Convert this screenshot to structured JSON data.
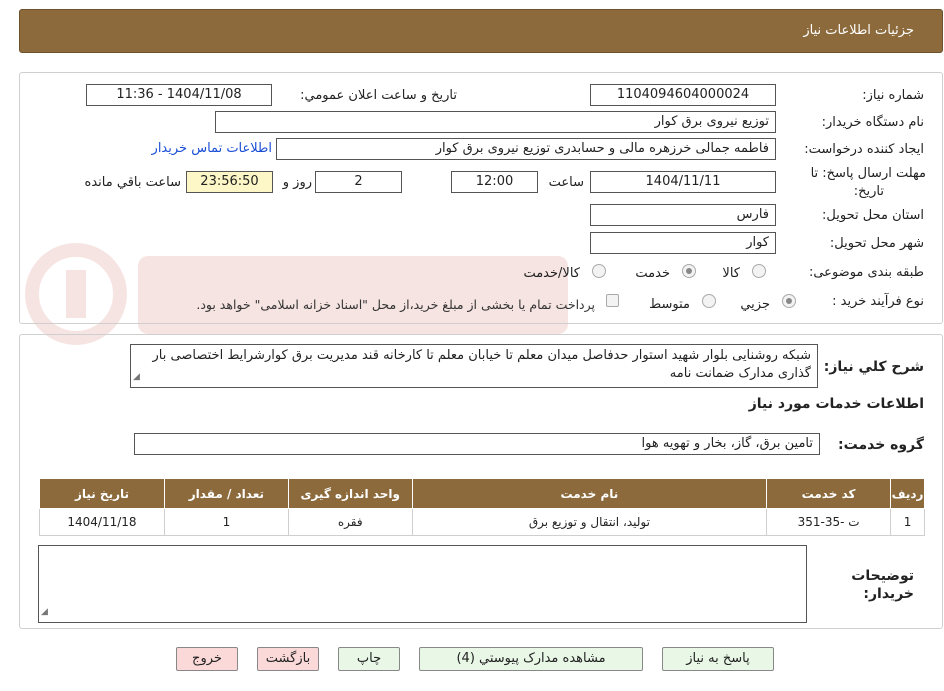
{
  "title": "جزئیات اطلاعات نیاز",
  "fields": {
    "need_no_label": "شماره نیاز:",
    "need_no": "1104094604000024",
    "announce_label": "تاریخ و ساعت اعلان عمومي:",
    "announce_value": "1404/11/08 - 11:36",
    "buyer_label": "نام دستگاه خریدار:",
    "buyer_value": "توزیع نیروی برق کوار",
    "creator_label": "ایجاد کننده درخواست:",
    "creator_value": "فاطمه جمالی خرزهره مالی و حسابدری توزیع نیروی برق کوار",
    "contact_link": "اطلاعات تماس خریدار",
    "deadline_label_1": "مهلت ارسال پاسخ: تا",
    "deadline_label_2": "تاریخ:",
    "deadline_date": "1404/11/11",
    "time_label": "ساعت",
    "deadline_time": "12:00",
    "days": "2",
    "days_label": "روز و",
    "remaining": "23:56:50",
    "remaining_label": "ساعت باقي مانده",
    "province_label": "استان محل تحویل:",
    "province": "فارس",
    "city_label": "شهر محل تحویل:",
    "city": "کوار",
    "category_label": "طبقه بندی موضوعی:",
    "cat_goods": "کالا",
    "cat_service": "خدمت",
    "cat_both": "کالا/خدمت",
    "process_label": "نوع فرآیند خرید :",
    "proc_small": "جزيي",
    "proc_medium": "متوسط",
    "payment_note": "پرداخت تمام یا بخشی از مبلغ خرید،از محل \"اسناد خزانه اسلامی\" خواهد بود."
  },
  "description": {
    "label": "شرح كلي نياز:",
    "text": "شبکه روشنایی بلوار شهید استوار حدفاصل میدان معلم تا خیابان معلم تا کارخانه قند مدیریت برق کوارشرایط اختصاصی بار گذاری مدارک ضمانت نامه"
  },
  "services": {
    "heading": "اطلاعات خدمات مورد نياز",
    "group_label": "گروه خدمت:",
    "group_value": "تامین برق، گاز، بخار و تهویه هوا",
    "columns": [
      "ردیف",
      "کد خدمت",
      "نام خدمت",
      "واحد اندازه گیری",
      "تعداد / مقدار",
      "تاریخ نیاز"
    ],
    "rows": [
      [
        "1",
        "ت -35-351",
        "تولید، انتقال و توزیع برق",
        "فقره",
        "1",
        "1404/11/18"
      ]
    ]
  },
  "buyer_notes": {
    "label_1": "توضیحات",
    "label_2": "خریدار:",
    "value": ""
  },
  "buttons": {
    "reply": "پاسخ به نیاز",
    "docs": "مشاهده مدارک پیوستي (4)",
    "print": "چاپ",
    "back": "بازگشت",
    "exit": "خروج"
  },
  "colors": {
    "header_bg": "#8c6a3c",
    "timer_bg": "#fdf7c7",
    "link": "#1a4fd6"
  }
}
